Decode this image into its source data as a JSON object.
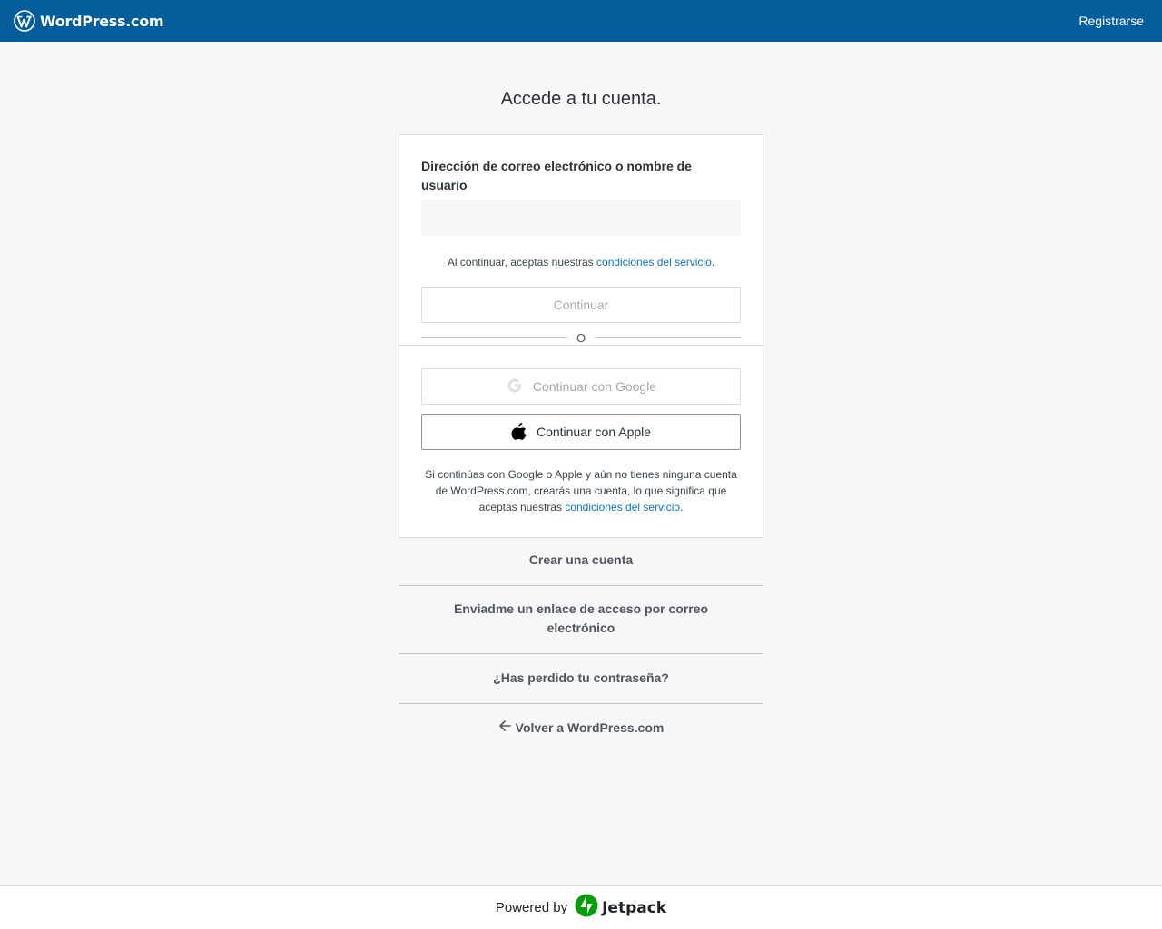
{
  "header": {
    "brand_name": "WordPress.com",
    "signup_label": "Registrarse",
    "background_color": "#055d9c"
  },
  "page": {
    "heading": "Accede a tu cuenta."
  },
  "login_form": {
    "email_label": "Dirección de correo electrónico o nombre de usuario",
    "email_value": "",
    "email_placeholder": "",
    "tos_prefix": "Al continuar, aceptas nuestras ",
    "tos_link": "condiciones del servicio",
    "tos_suffix": ".",
    "continue_label": "Continuar",
    "divider_label": "O"
  },
  "social": {
    "google_label": "Continuar con Google",
    "google_icon": "google-icon",
    "apple_label": "Continuar con Apple",
    "apple_icon": "apple-icon",
    "tos_prefix": "Si continúas con Google o Apple y aún no tienes ninguna cuenta de WordPress.com, crearás una cuenta, lo que significa que aceptas nuestras ",
    "tos_link": "condiciones del servicio",
    "tos_suffix": "."
  },
  "links": {
    "create_account": "Crear una cuenta",
    "magic_link": "Enviadme un enlace de acceso por correo electrónico",
    "lost_password": "¿Has perdido tu contraseña?",
    "back_label": "Volver a WordPress.com",
    "back_icon": "arrow-left-icon"
  },
  "footer": {
    "powered_by": "Powered by",
    "jetpack_name": "Jetpack",
    "jetpack_color": "#069e08"
  }
}
